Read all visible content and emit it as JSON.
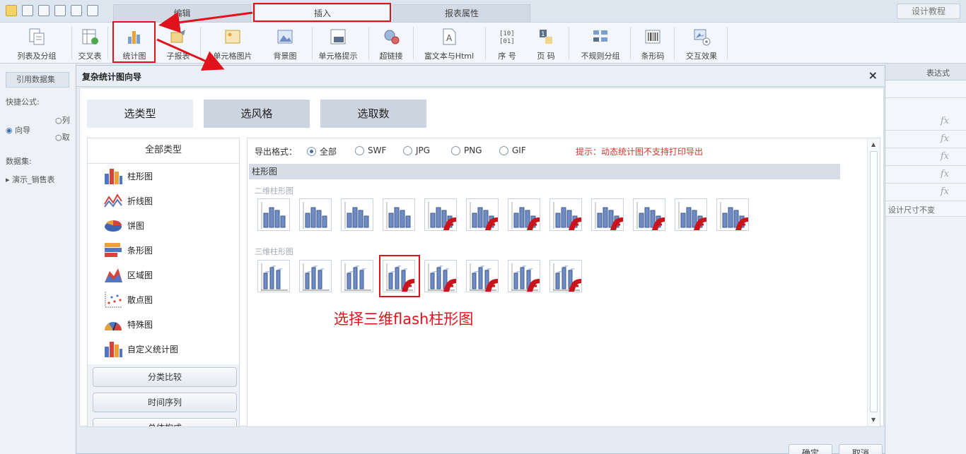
{
  "tabs": [
    {
      "label": "编辑"
    },
    {
      "label": "插入"
    },
    {
      "label": "报表属性"
    }
  ],
  "design_button": "设计教程",
  "toolbar": [
    {
      "label": "列表及分组",
      "icon": "list-group-icon"
    },
    {
      "label": "交叉表",
      "icon": "crosstab-icon"
    },
    {
      "label": "统计图",
      "icon": "chart-icon"
    },
    {
      "label": "子报表",
      "icon": "subreport-icon"
    },
    {
      "label": "单元格图片",
      "icon": "cell-image-icon"
    },
    {
      "label": "背景图",
      "icon": "background-image-icon"
    },
    {
      "label": "单元格提示",
      "icon": "cell-tip-icon"
    },
    {
      "label": "超链接",
      "icon": "hyperlink-icon"
    },
    {
      "label": "富文本与Html",
      "icon": "richtext-icon"
    },
    {
      "label": "序 号",
      "icon": "sequence-icon"
    },
    {
      "label": "页 码",
      "icon": "page-number-icon"
    },
    {
      "label": "不规则分组",
      "icon": "irregular-group-icon"
    },
    {
      "label": "条形码",
      "icon": "barcode-icon"
    },
    {
      "label": "交互效果",
      "icon": "interaction-icon"
    }
  ],
  "left_panel": {
    "ref_dataset": "引用数据集",
    "quick_formula": "快捷公式:",
    "wizard": "向导",
    "opt1": "列",
    "opt2": "取",
    "dataset": "数据集:",
    "tree_item": "演示_销售表"
  },
  "right_panel": {
    "header": "表达式",
    "fx": "fx",
    "note": "设计尺寸不变"
  },
  "dialog": {
    "title": "复杂统计图向导",
    "close": "×",
    "steps": [
      "选类型",
      "选风格",
      "选取数"
    ],
    "category_header": "全部类型",
    "categories": [
      "柱形图",
      "折线图",
      "饼图",
      "条形图",
      "区域图",
      "散点图",
      "特殊图",
      "自定义统计图"
    ],
    "group_buttons": [
      "分类比较",
      "时间序列",
      "总体构成"
    ],
    "export_label": "导出格式：",
    "formats": [
      "全部",
      "SWF",
      "JPG",
      "PNG",
      "GIF"
    ],
    "selected_format": "全部",
    "tip": "提示：动态统计图不支持打印导出",
    "section": "柱形图",
    "sub_2d": "二维柱形图",
    "sub_3d": "三维柱形图",
    "annotation": "选择三维flash柱形图",
    "ok": "确定",
    "cancel": "取消"
  },
  "colors": {
    "accent_red": "#e0121b",
    "bar_blue": "#6f8cc4",
    "flash_red": "#c9141b"
  }
}
